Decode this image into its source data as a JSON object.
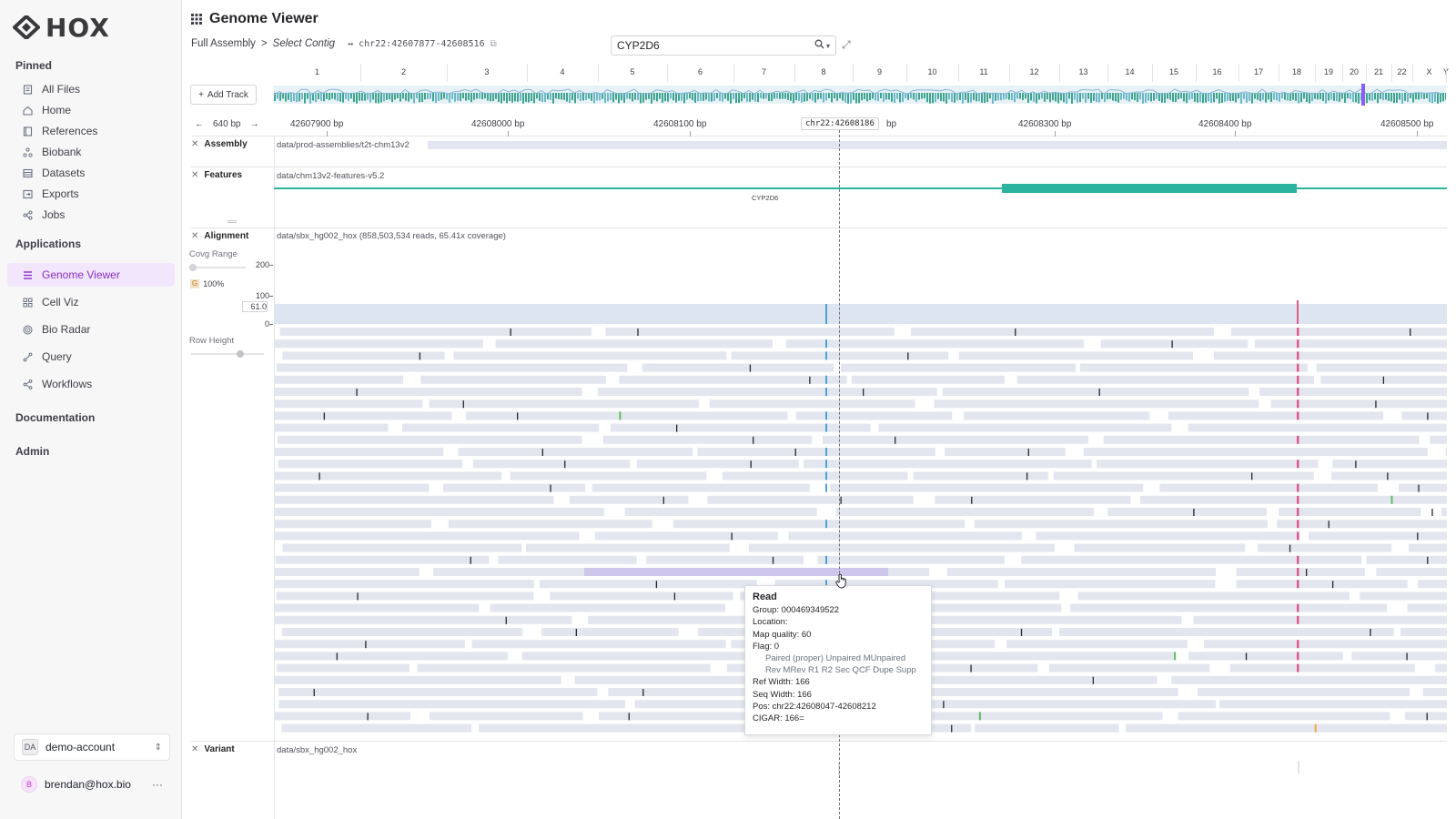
{
  "app": {
    "logo_text": "HOX"
  },
  "sidebar": {
    "pinned_heading": "Pinned",
    "pinned": [
      {
        "label": "All Files",
        "icon": "file-icon"
      },
      {
        "label": "Home",
        "icon": "home-icon"
      },
      {
        "label": "References",
        "icon": "book-icon"
      },
      {
        "label": "Biobank",
        "icon": "molecule-icon"
      },
      {
        "label": "Datasets",
        "icon": "table-icon"
      },
      {
        "label": "Exports",
        "icon": "export-icon"
      },
      {
        "label": "Jobs",
        "icon": "jobs-icon"
      }
    ],
    "applications_heading": "Applications",
    "applications": [
      {
        "label": "Genome Viewer",
        "icon": "genome-icon",
        "active": true
      },
      {
        "label": "Cell Viz",
        "icon": "cells-icon"
      },
      {
        "label": "Bio Radar",
        "icon": "radar-icon"
      },
      {
        "label": "Query",
        "icon": "query-icon"
      },
      {
        "label": "Workflows",
        "icon": "workflow-icon"
      }
    ],
    "documentation_label": "Documentation",
    "admin_label": "Admin",
    "account": {
      "initials": "DA",
      "name": "demo-account"
    },
    "user": {
      "initials": "B",
      "email": "brendan@hox.bio",
      "menu": "···"
    }
  },
  "header": {
    "title": "Genome Viewer",
    "crumb_root": "Full Assembly",
    "crumb_sep": ">",
    "crumb_current": "Select Contig",
    "locus": "chr22:42607877-42608516",
    "search_value": "CYP2D6"
  },
  "chromosomes": [
    "1",
    "2",
    "3",
    "4",
    "5",
    "6",
    "7",
    "8",
    "9",
    "10",
    "11",
    "12",
    "13",
    "14",
    "15",
    "16",
    "17",
    "18",
    "19",
    "20",
    "21",
    "22",
    "X",
    "Y"
  ],
  "add_track_label": "Add Track",
  "ruler": {
    "span_label": "640 bp",
    "ticks": [
      "42607900 bp",
      "42608000 bp",
      "42608100 bp",
      "42608300 bp",
      "42608400 bp",
      "42608500 bp"
    ],
    "cursor_pos": "chr22:42608186",
    "cursor_suffix": "bp"
  },
  "tracks": {
    "assembly": {
      "name": "Assembly",
      "path": "data/prod-assemblies/t2t-chm13v2"
    },
    "features": {
      "name": "Features",
      "path": "data/chm13v2-features-v5.2",
      "gene": "CYP2D6"
    },
    "alignment": {
      "name": "Alignment",
      "path": "data/sbx_hg002_hox (858,503,534 reads, 65.41x coverage)",
      "covg_range_label": "Covg Range",
      "covg_pct": "100%",
      "covg_badge": "G",
      "axis": [
        "200",
        "100",
        "61.0",
        "0"
      ],
      "row_height_label": "Row Height"
    },
    "variant": {
      "name": "Variant",
      "path": "data/sbx_hg002_hox"
    }
  },
  "tooltip": {
    "title": "Read",
    "group": "Group: 000469349522",
    "location": "Location:",
    "map_quality": "Map quality: 60",
    "flag": "Flag: 0",
    "flag_line1": "Paired (proper) Unpaired MUnpaired",
    "flag_line2": "Rev MRev R1 R2 Sec QCF Dupe Supp",
    "ref_width": "Ref Width: 166",
    "seq_width": "Seq Width: 166",
    "pos": "Pos: chr22:42608047-42608212",
    "cigar": "CIGAR: 166="
  },
  "colors": {
    "accent": "#8b2fc9",
    "feature": "#2bb3a0",
    "read": "#e3e6ee",
    "selected_read": "#cfc6ec",
    "mismatch_c": "#4aa3d8",
    "mismatch_g": "#f0a54a",
    "mismatch_t": "#e05a8c",
    "mismatch_a": "#5cbf5c"
  }
}
